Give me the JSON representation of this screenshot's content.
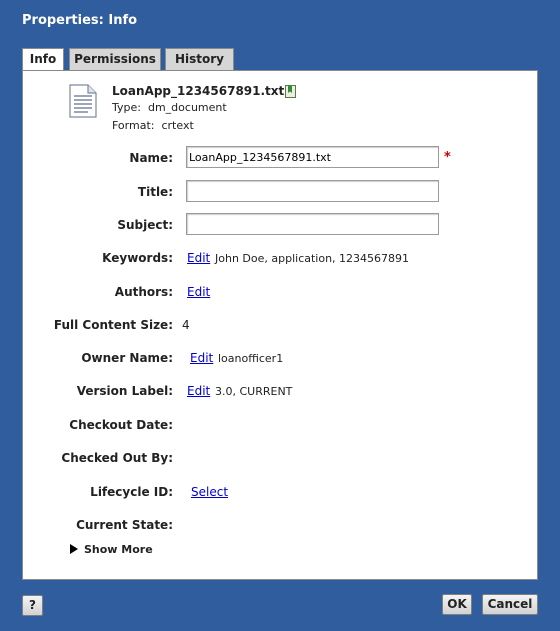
{
  "window": {
    "title": "Properties: Info"
  },
  "tabs": [
    {
      "label": "Info",
      "active": true
    },
    {
      "label": "Permissions",
      "active": false
    },
    {
      "label": "History",
      "active": false
    }
  ],
  "document": {
    "filename": "LoanApp_1234567891.txt",
    "type_label": "Type:",
    "type_value": "dm_document",
    "format_label": "Format:",
    "format_value": "crtext"
  },
  "fields": {
    "name_label": "Name:",
    "name_value": "LoanApp_1234567891.txt",
    "required_marker": "*",
    "title_label": "Title:",
    "title_value": "",
    "subject_label": "Subject:",
    "subject_value": "",
    "keywords_label": "Keywords:",
    "keywords_edit": "Edit",
    "keywords_value": "John Doe, application, 1234567891",
    "authors_label": "Authors:",
    "authors_edit": "Edit",
    "content_size_label": "Full Content Size:",
    "content_size_value": "4",
    "owner_label": "Owner Name:",
    "owner_edit": "Edit",
    "owner_value": "loanofficer1",
    "version_label": "Version Label:",
    "version_edit": "Edit",
    "version_value": "3.0, CURRENT",
    "checkout_date_label": "Checkout Date:",
    "checked_out_by_label": "Checked Out By:",
    "lifecycle_label": "Lifecycle ID:",
    "lifecycle_select": "Select",
    "current_state_label": "Current State:"
  },
  "show_more": "Show More",
  "footer": {
    "help": "?",
    "ok": "OK",
    "cancel": "Cancel"
  },
  "colors": {
    "window_bg": "#2f5d9e",
    "link": "#0000cc",
    "required": "#cc0000"
  },
  "icons": {
    "document": "text-document-icon",
    "file_status": "bookmark-icon",
    "show_more": "triangle-right-icon"
  }
}
